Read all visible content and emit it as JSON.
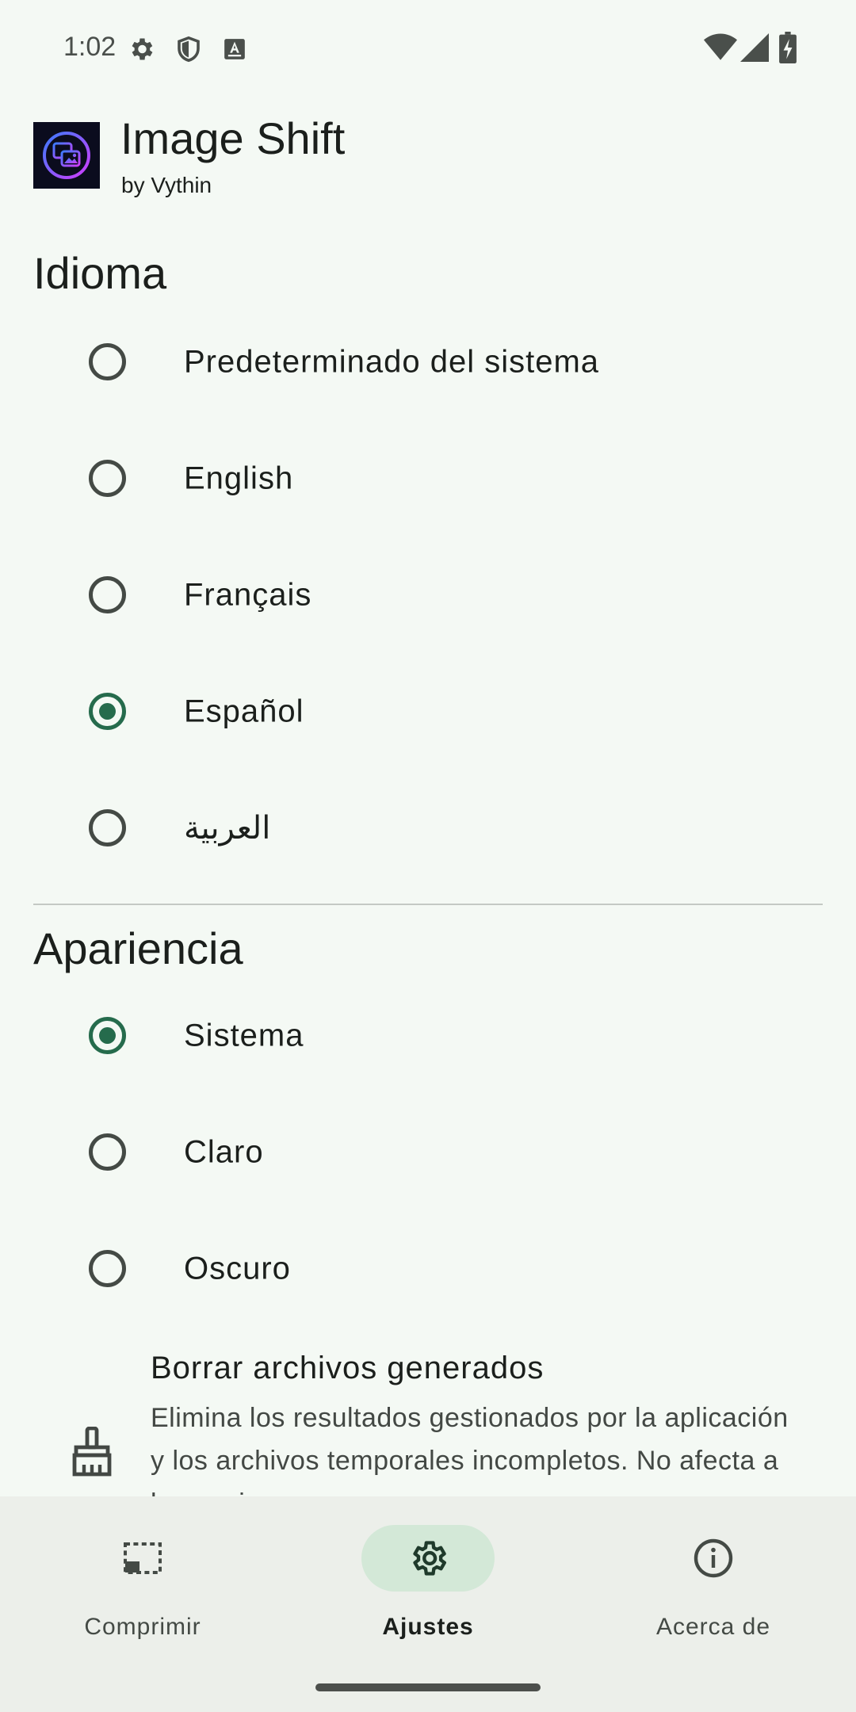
{
  "status_bar": {
    "time": "1:02",
    "icons": [
      "gear-icon",
      "shield-icon",
      "text-a-icon",
      "wifi-icon",
      "signal-icon",
      "battery-charging-icon"
    ]
  },
  "header": {
    "app_name": "Image Shift",
    "author": "by Vythin",
    "logo_icon": "image-shift-logo"
  },
  "language_section": {
    "title": "Idioma",
    "options": [
      {
        "label": "Predeterminado del sistema",
        "selected": false
      },
      {
        "label": "English",
        "selected": false
      },
      {
        "label": "Français",
        "selected": false
      },
      {
        "label": "Español",
        "selected": true
      },
      {
        "label": "العربية",
        "selected": false
      }
    ]
  },
  "appearance_section": {
    "title": "Apariencia",
    "options": [
      {
        "label": "Sistema",
        "selected": true
      },
      {
        "label": "Claro",
        "selected": false
      },
      {
        "label": "Oscuro",
        "selected": false
      }
    ]
  },
  "clear_files": {
    "icon": "broom-icon",
    "title": "Borrar archivos generados",
    "description": "Elimina los resultados gestionados por la aplicación y los archivos temporales incompletos. No afecta a las copias"
  },
  "bottom_nav": {
    "items": [
      {
        "label": "Comprimir",
        "icon": "compress-icon",
        "active": false
      },
      {
        "label": "Ajustes",
        "icon": "settings-icon",
        "active": true
      },
      {
        "label": "Acerca de",
        "icon": "info-icon",
        "active": false
      }
    ]
  },
  "colors": {
    "background": "#f4f9f4",
    "accent": "#256b4c",
    "nav_background": "#ecefea",
    "nav_active_pill": "#d3e8d7"
  }
}
